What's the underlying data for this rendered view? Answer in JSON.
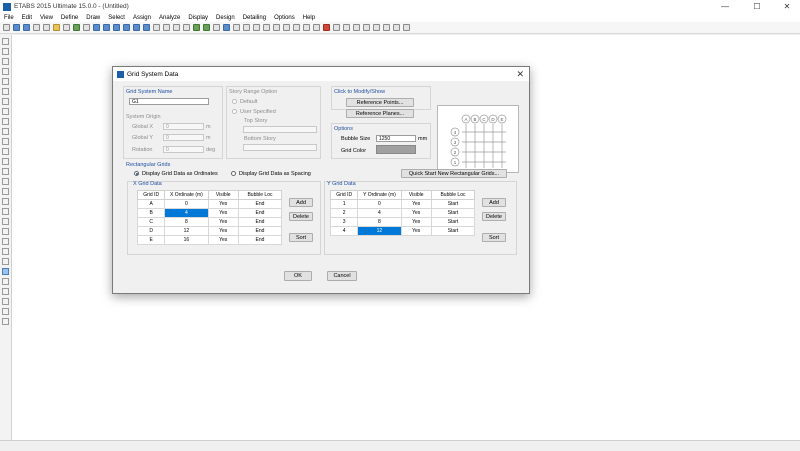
{
  "window": {
    "title": "ETABS 2015 Ultimate 15.0.0 - (Untitled)",
    "minimize": "—",
    "maximize": "☐",
    "close": "✕"
  },
  "menu": [
    "File",
    "Edit",
    "View",
    "Define",
    "Draw",
    "Select",
    "Assign",
    "Analyze",
    "Display",
    "Design",
    "Detailing",
    "Options",
    "Help"
  ],
  "dialog": {
    "title": "Grid System Data",
    "close_glyph": "✕",
    "grid_system_name_label": "Grid System Name",
    "grid_system_name": "G1",
    "system_origin_label": "System Origin",
    "global_x_label": "Global X",
    "global_x": "0",
    "global_x_unit": "m",
    "global_y_label": "Global Y",
    "global_y": "0",
    "global_y_unit": "m",
    "rotation_label": "Rotation",
    "rotation": "0",
    "rotation_unit": "deg",
    "story_range_label": "Story Range Option",
    "default_label": "Default",
    "user_specified_label": "User Specified",
    "top_story_label": "Top Story",
    "bottom_story_label": "Bottom Story",
    "click_modify_label": "Click to Modify/Show",
    "reference_points_button": "Reference Points...",
    "reference_planes_button": "Reference Planes...",
    "options_label": "Options",
    "bubble_size_label": "Bubble Size",
    "bubble_size": "1250",
    "bubble_size_unit": "mm",
    "grid_color_label": "Grid Color",
    "grid_color": "#a0a0a0",
    "rectangular_grids_label": "Rectangular Grids",
    "display_ordinates_label": "Display Grid Data as Ordinates",
    "display_spacing_label": "Display Grid Data as Spacing",
    "quick_start_button": "Quick Start New Rectangular Grids...",
    "x_grid_label": "X Grid Data",
    "y_grid_label": "Y Grid Data",
    "x_headers": [
      "Grid ID",
      "X Ordinate (m)",
      "Visible",
      "Bubble Loc"
    ],
    "y_headers": [
      "Grid ID",
      "Y Ordinate (m)",
      "Visible",
      "Bubble Loc"
    ],
    "x_rows": [
      [
        "A",
        "0",
        "Yes",
        "End"
      ],
      [
        "B",
        "4",
        "Yes",
        "End"
      ],
      [
        "C",
        "8",
        "Yes",
        "End"
      ],
      [
        "D",
        "12",
        "Yes",
        "End"
      ],
      [
        "E",
        "16",
        "Yes",
        "End"
      ]
    ],
    "y_rows": [
      [
        "1",
        "0",
        "Yes",
        "Start"
      ],
      [
        "2",
        "4",
        "Yes",
        "Start"
      ],
      [
        "3",
        "8",
        "Yes",
        "Start"
      ],
      [
        "4",
        "12",
        "Yes",
        "Start"
      ]
    ],
    "add_label": "Add",
    "delete_label": "Delete",
    "sort_label": "Sort",
    "ok_label": "OK",
    "cancel_label": "Cancel",
    "preview_x_bubbles": [
      "A",
      "B",
      "C",
      "D",
      "E"
    ],
    "preview_y_bubbles": [
      "4",
      "3",
      "2",
      "1"
    ]
  }
}
